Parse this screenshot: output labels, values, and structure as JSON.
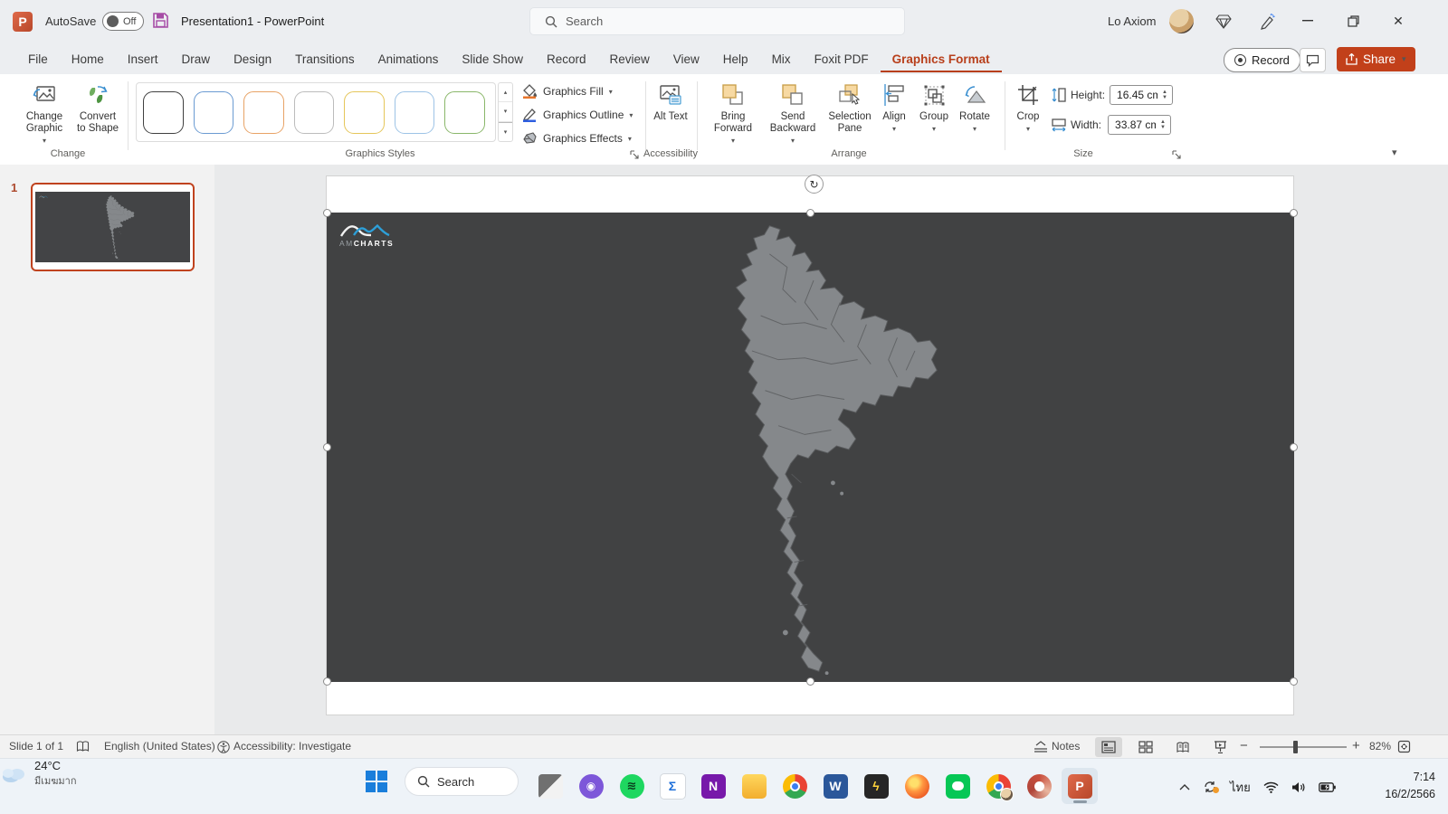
{
  "titlebar": {
    "autosave_label": "AutoSave",
    "autosave_state": "Off",
    "document_title": "Presentation1  -  PowerPoint",
    "search_placeholder": "Search",
    "user_name": "Lo Axiom",
    "app_initial": "P"
  },
  "tabs": [
    "File",
    "Home",
    "Insert",
    "Draw",
    "Design",
    "Transitions",
    "Animations",
    "Slide Show",
    "Record",
    "Review",
    "View",
    "Help",
    "Mix",
    "Foxit PDF",
    "Graphics Format"
  ],
  "active_tab": "Graphics Format",
  "actions": {
    "record": "Record",
    "share": "Share"
  },
  "ribbon": {
    "change": {
      "change_graphic": "Change Graphic",
      "convert_to_shape": "Convert to Shape",
      "label": "Change"
    },
    "styles": {
      "label": "Graphics Styles",
      "fill": "Graphics Fill",
      "outline": "Graphics Outline",
      "effects": "Graphics Effects",
      "swatches": [
        {
          "name": "dark",
          "style": "border-color:#404040"
        },
        {
          "name": "blue",
          "style": "border-color:#6b9bd2"
        },
        {
          "name": "orange",
          "style": "border-color:#e8a366"
        },
        {
          "name": "gray",
          "style": "border-color:#bcbcbc"
        },
        {
          "name": "yellow",
          "style": "border-color:#e5c65a"
        },
        {
          "name": "light-blue",
          "style": "border-color:#9dc3e6"
        },
        {
          "name": "green",
          "style": "border-color:#8ab76a"
        }
      ]
    },
    "accessibility": {
      "alt_text": "Alt Text",
      "label": "Accessibility"
    },
    "arrange": {
      "bring_forward": "Bring Forward",
      "send_backward": "Send Backward",
      "selection_pane": "Selection Pane",
      "align": "Align",
      "group": "Group",
      "rotate": "Rotate",
      "label": "Arrange"
    },
    "size": {
      "crop": "Crop",
      "height_label": "Height:",
      "height_value": "16.45 cm",
      "width_label": "Width:",
      "width_value": "33.87 cm",
      "label": "Size"
    }
  },
  "slide_panel": {
    "slide_number": "1"
  },
  "canvas": {
    "logo_am": "AM",
    "logo_charts": "CHARTS"
  },
  "statusbar": {
    "slide_indicator": "Slide 1 of 1",
    "language": "English (United States)",
    "accessibility": "Accessibility: Investigate",
    "notes": "Notes",
    "zoom": "82%"
  },
  "taskbar": {
    "weather_temp": "24°C",
    "weather_desc": "มีเมฆมาก",
    "search_label": "Search",
    "language_indicator": "ไทย",
    "time": "7:14",
    "date": "16/2/2566",
    "apps": [
      {
        "name": "photos",
        "glyph": "",
        "style": "background:linear-gradient(135deg,#707070 0 49%,#f2f2f2 50% 100%);border-radius:4px"
      },
      {
        "name": "camera-app",
        "glyph": "◉",
        "style": "background:#7d57d9;border-radius:50%;font-size:12px"
      },
      {
        "name": "spotify",
        "glyph": "≋",
        "style": "background:#1ed760;border-radius:50%;color:#0b3d1d;font-size:13px"
      },
      {
        "name": "sigma-app",
        "glyph": "Σ",
        "style": "background:#fff;color:#1e6fd9;border:1px solid #d3d8dd;border-radius:5px"
      },
      {
        "name": "onenote",
        "glyph": "N",
        "style": "background:#7719aa;border-radius:5px"
      },
      {
        "name": "file-explorer",
        "glyph": "",
        "style": "background:linear-gradient(180deg,#ffd75e,#f2ae2e);border-radius:5px"
      },
      {
        "name": "chrome",
        "glyph": "",
        "style": "background:conic-gradient(#ea4335 0 33%,#34a853 33% 66%,#fbbc05 66% 100%);border-radius:50%"
      },
      {
        "name": "word",
        "glyph": "W",
        "style": "background:#2b579a;border-radius:5px"
      },
      {
        "name": "zap-app",
        "glyph": "ϟ",
        "style": "background:#262626;color:#ffd43b;border-radius:5px"
      },
      {
        "name": "firefox",
        "glyph": "",
        "style": "background:radial-gradient(circle at 38% 35%,#ffdf6b 0 18%,#ff9640 40%,#e84e1f 85%);border-radius:50%"
      },
      {
        "name": "line",
        "glyph": "",
        "style": "background:#06c755;border-radius:6px"
      },
      {
        "name": "chrome-profile",
        "glyph": "",
        "style": "background:conic-gradient(#ea4335 0 33%,#34a853 33% 66%,#fbbc05 66% 100%);border-radius:50%"
      },
      {
        "name": "ring-app",
        "glyph": "",
        "style": "background:conic-gradient(#c94f3d,#e8b59f,#b0453a,#c94f3d);border-radius:50%"
      },
      {
        "name": "powerpoint",
        "glyph": "P",
        "style": "background:linear-gradient(135deg,#e06a4a,#b7472a);border-radius:5px"
      }
    ]
  },
  "colors": {
    "accent_tab": "#b83f1b",
    "share_button": "#c2401a",
    "selection_border": "#c0431f",
    "slide_graphic_bg": "#414243",
    "map_fill": "#85888b",
    "map_border": "#5a5c5e",
    "logo_blue": "#2d9fd8"
  },
  "icons": {
    "search-icon": "magnifier",
    "save-icon": "floppy-disk",
    "designer-icon": "gem",
    "draw-pen-icon": "pen-sparkle",
    "minimize-icon": "dash",
    "restore-icon": "overlapping-squares",
    "close-icon": "x",
    "record-dot-icon": "ring-dot",
    "comment-icon": "speech-bubble",
    "share-icon": "arrow-up-box",
    "chevron-down-icon": "▾",
    "rotate-handle-icon": "circular-arrow",
    "wifi-icon": "arcs",
    "speaker-icon": "speaker-waves",
    "battery-icon": "battery",
    "spellcheck-icon": "open-book",
    "accessibility-icon": "person-circle",
    "notes-icon": "lines-caret",
    "fit-window-icon": "frame-arrows",
    "cloud-icon": "cloud"
  }
}
